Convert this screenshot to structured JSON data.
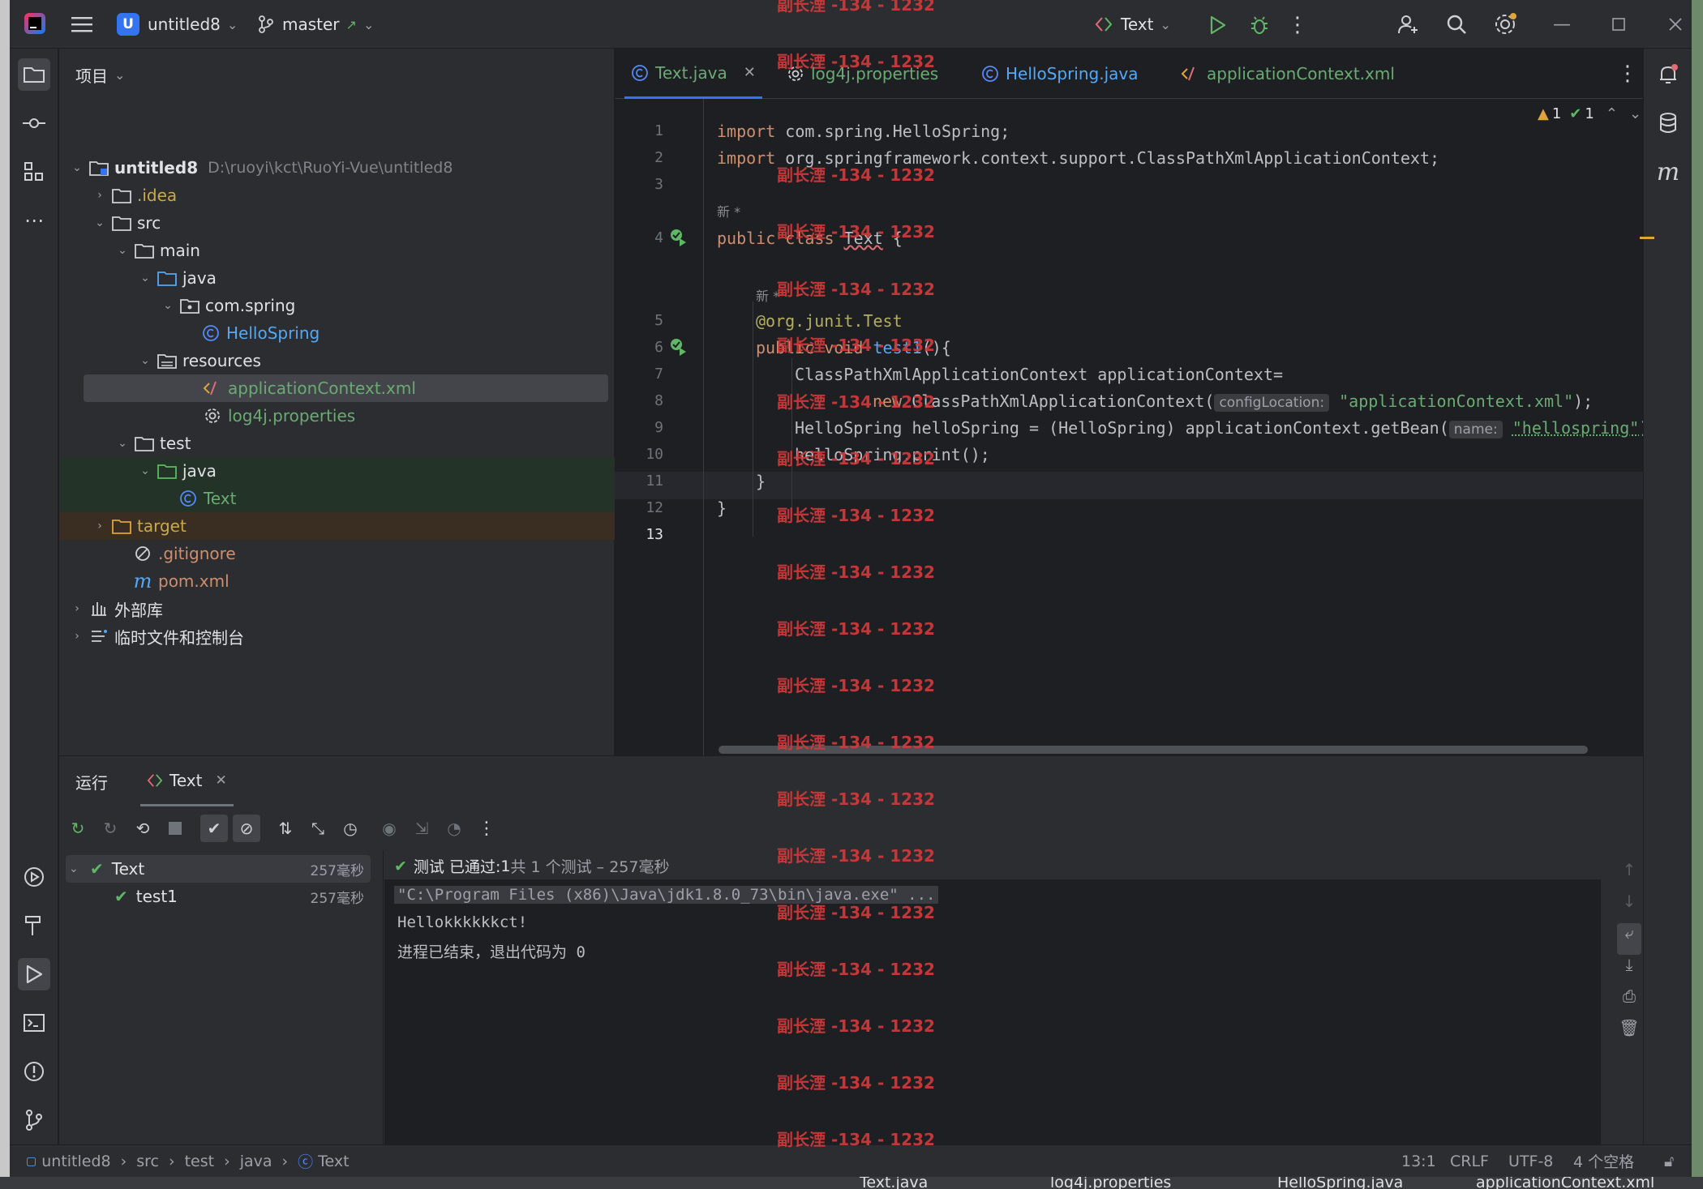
{
  "titlebar": {
    "project_badge": "U",
    "project_name": "untitled8",
    "branch": "master",
    "branch_arrow": "↗",
    "run_config": "Text"
  },
  "project_panel": {
    "title": "项目",
    "tree": [
      {
        "label": "untitled8",
        "suffix": "D:\\ruoyi\\kct\\RuoYi-Vue\\untitled8"
      },
      {
        "label": ".idea"
      },
      {
        "label": "src"
      },
      {
        "label": "main"
      },
      {
        "label": "java"
      },
      {
        "label": "com.spring"
      },
      {
        "label": "HelloSpring"
      },
      {
        "label": "resources"
      },
      {
        "label": "applicationContext.xml"
      },
      {
        "label": "log4j.properties"
      },
      {
        "label": "test"
      },
      {
        "label": "java"
      },
      {
        "label": "Text"
      },
      {
        "label": "target"
      },
      {
        "label": ".gitignore"
      },
      {
        "label": "pom.xml"
      },
      {
        "label": "外部库"
      },
      {
        "label": "临时文件和控制台"
      }
    ]
  },
  "editor": {
    "tabs": [
      {
        "label": "Text.java"
      },
      {
        "label": "log4j.properties"
      },
      {
        "label": "HelloSpring.java"
      },
      {
        "label": "applicationContext.xml"
      }
    ],
    "inspections": {
      "warnings": "1",
      "ok": "1"
    },
    "line_numbers": [
      "1",
      "2",
      "3",
      "4",
      "5",
      "6",
      "7",
      "8",
      "9",
      "10",
      "11",
      "12",
      "13"
    ],
    "inlay_new": "新 *",
    "code": {
      "l1_kw": "import",
      "l1_rest": " com.spring.HelloSpring;",
      "l2_kw": "import",
      "l2_rest": " org.springframework.context.support.ClassPathXmlApplicationContext;",
      "l4_kw": "public class",
      "l4_name": "Text",
      "l4_rest": " {",
      "l5": "@org.junit.Test",
      "l6_kw": "public void",
      "l6_fn": "test1",
      "l6_rest": "(){",
      "l7": "ClassPathXmlApplicationContext applicationContext=",
      "l8_kw": "new",
      "l8_rest": " ClassPathXmlApplicationContext(",
      "l8_hint": "configLocation:",
      "l8_str": "\"applicationContext.xml\"",
      "l8_end": ");",
      "l9": "HelloSpring helloSpring = (HelloSpring) applicationContext.getBean(",
      "l9_hint": "name:",
      "l9_str": "\"hellospring\"",
      "l9_end": ");",
      "l10": "helloSpring.print();",
      "l11": "}",
      "l12": "}"
    }
  },
  "run_panel": {
    "title": "运行",
    "tab": "Text",
    "tests": [
      {
        "name": "Text",
        "time": "257毫秒"
      },
      {
        "name": "test1",
        "time": "257毫秒"
      }
    ],
    "summary_prefix": "测试 已通过:",
    "summary_count": "1",
    "summary_rest": "共 1 个测试 – 257毫秒",
    "console_lines": [
      "\"C:\\Program Files (x86)\\Java\\jdk1.8.0_73\\bin\\java.exe\" ...",
      "Hellokkkkkkct!",
      "进程已结束，退出代码为 0"
    ]
  },
  "statusbar": {
    "breadcrumbs": [
      "untitled8",
      "src",
      "test",
      "java",
      "Text"
    ],
    "position": "13:1",
    "line_sep": "CRLF",
    "encoding": "UTF-8",
    "indent": "4 个空格"
  },
  "taskbar_tabs": [
    "Text.java",
    "log4j.properties",
    "HelloSpring.java",
    "applicationContext.xml"
  ],
  "watermark": "副长湮 -134 - 1232",
  "colors": {
    "accent": "#3574f0",
    "success": "#5fb865",
    "warning": "#e0a43a",
    "watermark": "#d23a3a"
  }
}
